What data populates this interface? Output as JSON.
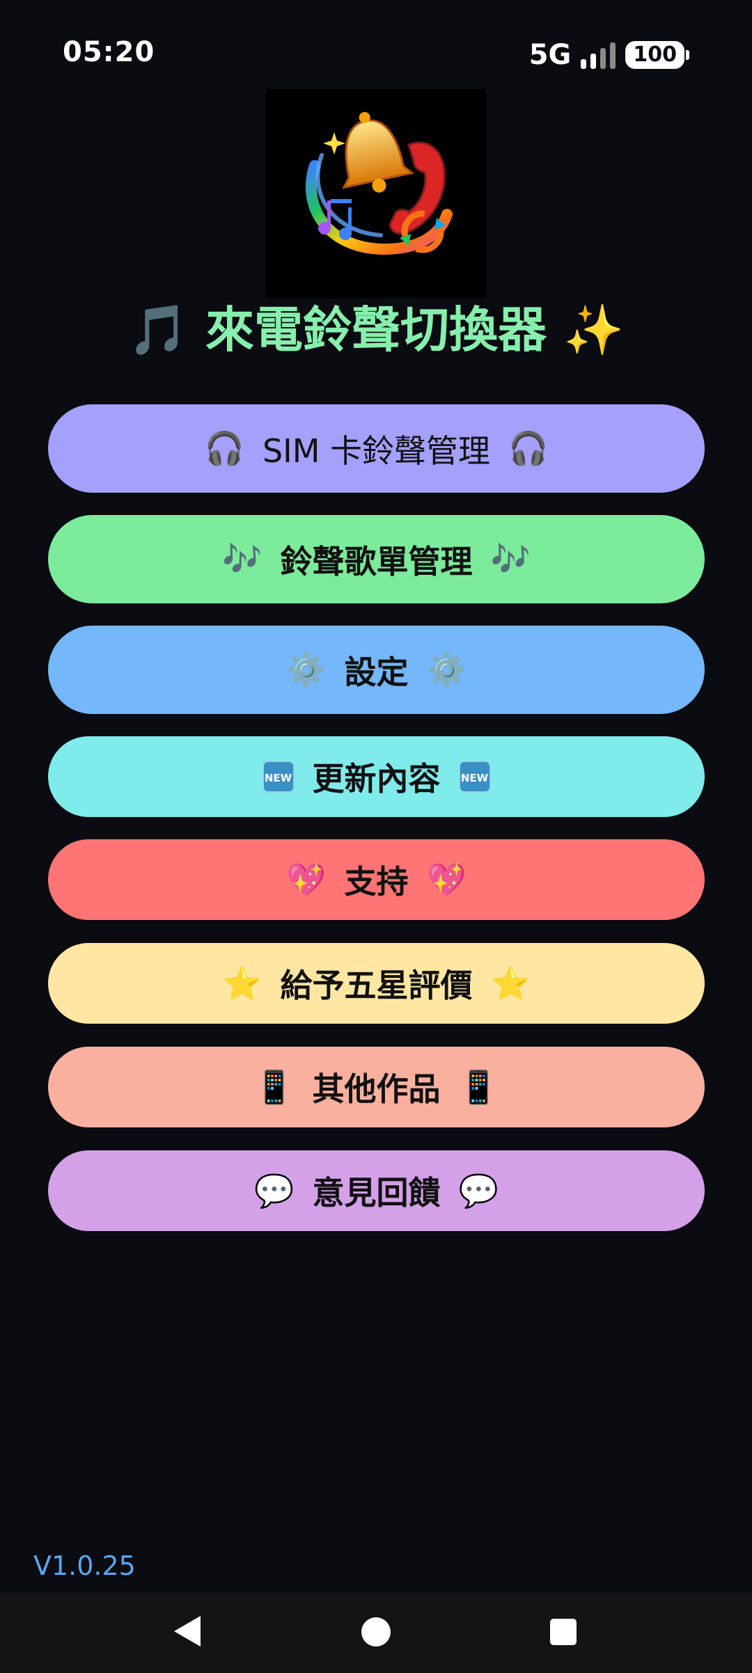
{
  "status_bar": {
    "time": "05:20",
    "network": "5G",
    "battery": "100"
  },
  "logo": {
    "icon": "bell-and-phone-icon"
  },
  "app_title": "🎵 來電鈴聲切換器 ✨",
  "menu": [
    {
      "id": "sim",
      "emoji": "🎧",
      "label": "SIM 卡鈴聲管理",
      "color": "#a5a0fb"
    },
    {
      "id": "playlist",
      "emoji": "🎶",
      "label": "鈴聲歌單管理",
      "color": "#7ceb9c"
    },
    {
      "id": "settings",
      "emoji": "⚙️",
      "label": "設定",
      "color": "#74b7fb"
    },
    {
      "id": "updates",
      "emoji": "NEW",
      "label": "更新內容",
      "color": "#80ebeb"
    },
    {
      "id": "support",
      "emoji": "💖",
      "label": "支持",
      "color": "#ff7474"
    },
    {
      "id": "rate",
      "emoji": "⭐",
      "label": "給予五星評價",
      "color": "#ffe7a3"
    },
    {
      "id": "apps",
      "emoji": "📱",
      "label": "其他作品",
      "color": "#f9b09f"
    },
    {
      "id": "feedback",
      "emoji": "💬",
      "label": "意見回饋",
      "color": "#d4a0e8"
    }
  ],
  "version": "V1.0.25",
  "colors": {
    "background": "#0b0b12",
    "title": "#86efac",
    "version": "#5aa6ee"
  }
}
